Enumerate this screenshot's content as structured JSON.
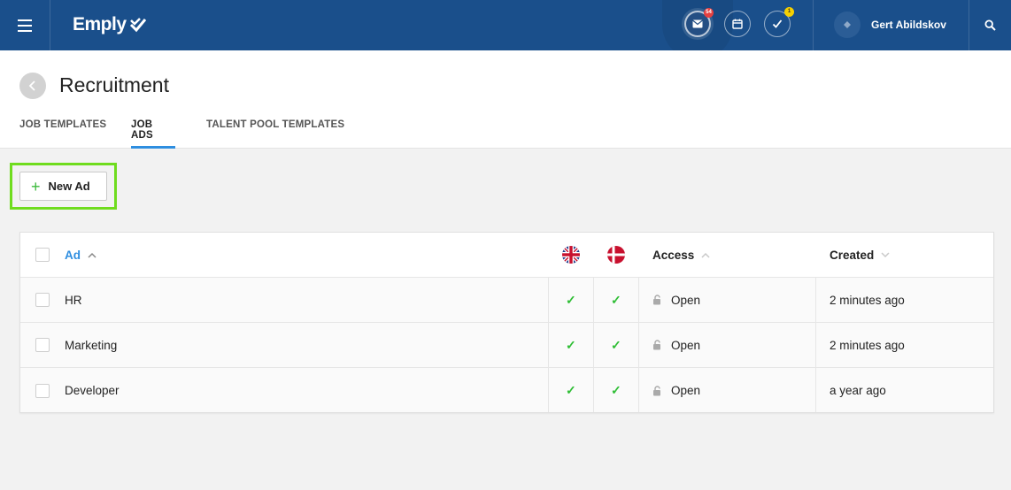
{
  "topbar": {
    "logo_text": "Emply",
    "mail_badge": "54",
    "tasks_badge": "1",
    "user_name": "Gert Abildskov",
    "brand_color": "#1a4f8b"
  },
  "header": {
    "title": "Recruitment",
    "tabs": [
      {
        "label": "JOB TEMPLATES",
        "active": false
      },
      {
        "label": "JOB ADS",
        "active": true
      },
      {
        "label": "TALENT POOL TEMPLATES",
        "active": false
      }
    ]
  },
  "toolbar": {
    "new_ad_plus": "+",
    "new_ad_label": "New Ad"
  },
  "table": {
    "columns": {
      "ad": "Ad",
      "lang_en": "uk-flag-icon",
      "lang_da": "dk-flag-icon",
      "access": "Access",
      "created": "Created"
    },
    "check_glyph": "✓",
    "rows": [
      {
        "ad": "HR",
        "en": true,
        "da": true,
        "access": "Open",
        "created": "2 minutes ago"
      },
      {
        "ad": "Marketing",
        "en": true,
        "da": true,
        "access": "Open",
        "created": "2 minutes ago"
      },
      {
        "ad": "Developer",
        "en": true,
        "da": true,
        "access": "Open",
        "created": "a year ago"
      }
    ]
  },
  "colors": {
    "accent": "#2e8ee0",
    "check": "#2fbe35",
    "highlight": "#6fdc1e"
  }
}
